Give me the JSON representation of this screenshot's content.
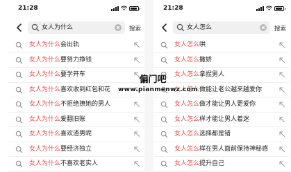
{
  "left": {
    "time": "21:28",
    "query": "女人为什么",
    "search_label": "搜索",
    "suggestions": [
      {
        "prefix": "女人为什么",
        "rest": "会出轨"
      },
      {
        "prefix": "女人为什么",
        "rest": "要努力挣钱"
      },
      {
        "prefix": "女人为什么",
        "rest": "要学开车"
      },
      {
        "prefix": "女人为什么",
        "rest": "喜欢收到红包和花"
      },
      {
        "prefix": "女人为什么",
        "rest": "不拒绝撩她的男人"
      },
      {
        "prefix": "女人为什么",
        "rest": "爱翻旧账"
      },
      {
        "prefix": "女人为什么",
        "rest": "喜欢渣男呢"
      },
      {
        "prefix": "女人为什么",
        "rest": "要经济独立"
      },
      {
        "prefix": "女人为什么",
        "rest": "不喜欢老实人"
      }
    ]
  },
  "right": {
    "time": "21:28",
    "query": "女人怎么",
    "search_label": "搜索",
    "suggestions": [
      {
        "prefix": "女人怎么",
        "rest": "哄"
      },
      {
        "prefix": "女人怎么",
        "rest": "撒娇"
      },
      {
        "prefix": "女人怎么",
        "rest": "拿捏男人"
      },
      {
        "prefix": "女人怎么",
        "rest": "做能让老公越来越爱你"
      },
      {
        "prefix": "女人怎么",
        "rest": "做才能让男人更爱你"
      },
      {
        "prefix": "女人怎么",
        "rest": "样才能让男人着迷"
      },
      {
        "prefix": "女人怎么",
        "rest": "选择都是错"
      },
      {
        "prefix": "女人怎么",
        "rest": "样在男人面前保持神秘感"
      },
      {
        "prefix": "女人怎么",
        "rest": "提升自己"
      }
    ]
  },
  "watermark": {
    "title": "偏门吧",
    "url": "www.pianmenwz.com"
  },
  "icons": {
    "back": "chevron-left-icon",
    "search": "magnifier-icon",
    "clear": "clear-circle-icon",
    "fill_query": "arrow-up-left-icon",
    "signal": "signal-icon",
    "wifi": "wifi-icon",
    "battery": "battery-icon"
  },
  "colors": {
    "highlight": "#e24b4b",
    "search_box": "#f0f0f0",
    "gutter": "#f6f6f6"
  }
}
